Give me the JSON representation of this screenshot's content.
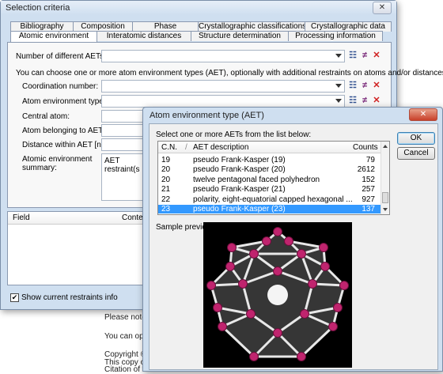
{
  "background_doc": {
    "lines": [
      "Please note:",
      "You can oper",
      "Copyright ©",
      "This copy o",
      "Citation of th"
    ]
  },
  "main": {
    "title": "Selection criteria",
    "close_label": "✕",
    "tabs_row1": [
      "Bibliography",
      "Composition",
      "Phase",
      "Crystallographic classifications",
      "Crystallographic data"
    ],
    "tabs_row2": [
      "Atomic environment",
      "Interatomic distances",
      "Structure determination",
      "Processing information"
    ],
    "fields": {
      "num_aets": "Number of different AETs:",
      "intro": "You can choose one or more atom environment types (AET), optionally with additional restraints on atoms and/or distances:",
      "coord_number": "Coordination number:",
      "aet_type": "Atom environment type:",
      "central_atom": "Central atom:",
      "atom_belonging": "Atom belonging to AET:",
      "distance": "Distance within AET [nm]:",
      "summary": "Atomic environment summary:",
      "summary_value": "AET restraint(s"
    },
    "table": {
      "col_field": "Field",
      "col_content": "Content"
    },
    "checkbox_label": "Show current restraints info",
    "checkbox_mark": "✔"
  },
  "aet": {
    "title": "Atom environment type (AET)",
    "close_label": "✕",
    "instruction": "Select one or more AETs from the list below:",
    "ok_label": "OK",
    "cancel_label": "Cancel",
    "columns": [
      "C.N.",
      "/",
      "AET description",
      "Counts"
    ],
    "rows": [
      {
        "cn": "19",
        "desc": "pseudo Frank-Kasper (19)",
        "count": "79"
      },
      {
        "cn": "20",
        "desc": "pseudo Frank-Kasper (20)",
        "count": "2612"
      },
      {
        "cn": "20",
        "desc": "twelve pentagonal faced polyhedron",
        "count": "152"
      },
      {
        "cn": "21",
        "desc": "pseudo Frank-Kasper (21)",
        "count": "257"
      },
      {
        "cn": "22",
        "desc": "polarity, eight-equatorial capped hexagonal ...",
        "count": "927"
      },
      {
        "cn": "23",
        "desc": "pseudo Frank-Kasper (23)",
        "count": "137"
      }
    ],
    "selected_row": 5,
    "preview_label": "Sample preview:",
    "colors": {
      "selection": "#3399ff",
      "atom": "#c0246e",
      "center_atom": "#f4f4f4"
    }
  }
}
